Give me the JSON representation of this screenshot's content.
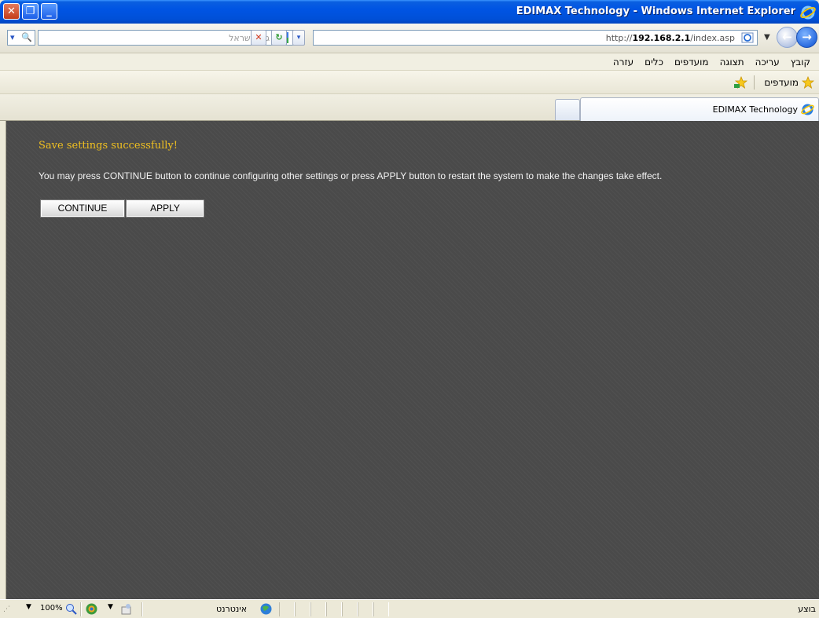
{
  "window": {
    "title": "EDIMAX Technology - Windows Internet Explorer"
  },
  "toolbar": {
    "search_placeholder": "גוגל ישראל",
    "url_prefix": "http://",
    "url_host": "192.168.2.1",
    "url_path": "/index.asp"
  },
  "menu": {
    "items": [
      "קובץ",
      "עריכה",
      "תצוגה",
      "מועדפים",
      "כלים",
      "עזרה"
    ]
  },
  "favorites": {
    "label": "מועדפים"
  },
  "tabs": [
    {
      "label": "EDIMAX Technology",
      "active": true
    }
  ],
  "page": {
    "success_message": "Save settings successfully!",
    "info_message": "You may press CONTINUE button to continue configuring other settings or press APPLY button to restart the system to make the changes take effect.",
    "continue_label": "CONTINUE",
    "apply_label": "APPLY"
  },
  "statusbar": {
    "zoom": "100%",
    "zone": "אינטרנט",
    "status": "בוצע"
  },
  "colors": {
    "success_text": "#f0c020",
    "content_bg": "#4a4a4a",
    "titlebar": "#0054e3"
  }
}
